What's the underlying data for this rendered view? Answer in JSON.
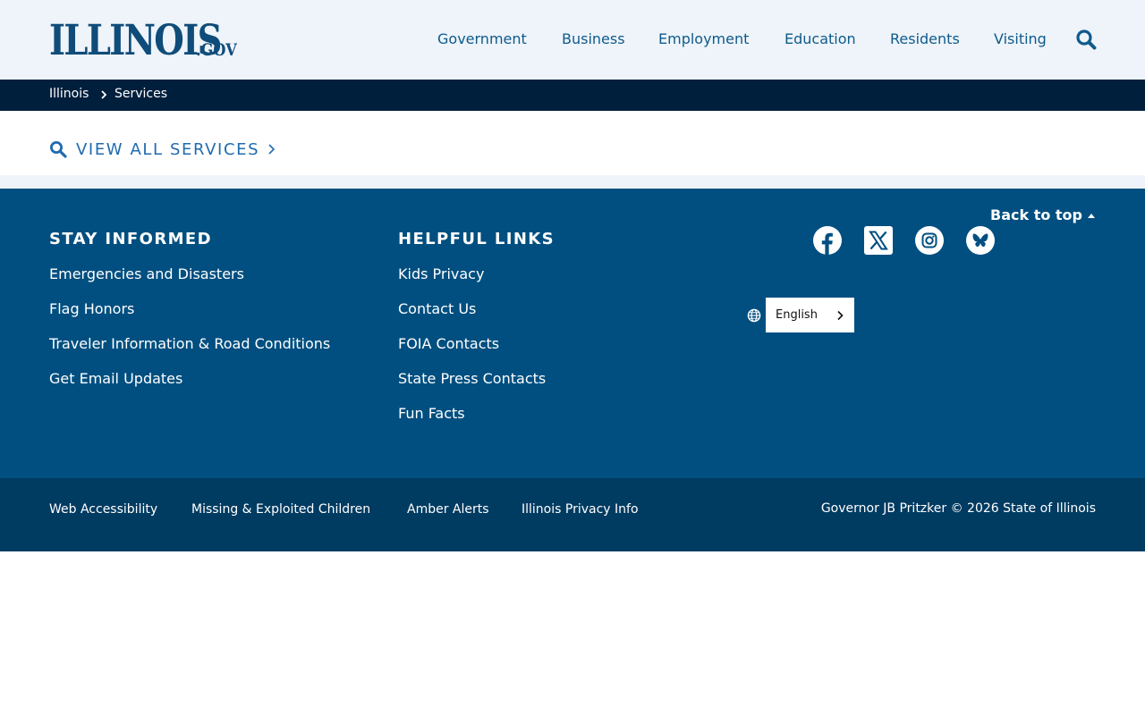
{
  "header": {
    "logo": {
      "main": "ILLINOIS",
      "suffix": ".GOV"
    },
    "nav": [
      "Government",
      "Business",
      "Employment",
      "Education",
      "Residents",
      "Visiting"
    ],
    "search_icon": "search-icon"
  },
  "breadcrumb": {
    "items": [
      "Illinois",
      "Services"
    ],
    "separator_icon": "chevron-right-icon"
  },
  "services": {
    "view_all_label": "VIEW ALL SERVICES",
    "icon": "search-icon",
    "chevron_icon": "chevron-right-icon"
  },
  "footer": {
    "back_to_top": "Back to top",
    "stay_informed": {
      "title": "STAY INFORMED",
      "links": [
        "Emergencies and Disasters",
        "Flag Honors",
        "Traveler Information & Road Conditions",
        "Get Email Updates"
      ]
    },
    "helpful_links": {
      "title": "HELPFUL LINKS",
      "links": [
        "Kids Privacy",
        "Contact Us",
        "FOIA Contacts",
        "State Press Contacts",
        "Fun Facts"
      ]
    },
    "social_icons": [
      "facebook-icon",
      "x-twitter-icon",
      "instagram-icon",
      "bluesky-icon"
    ],
    "language": {
      "selected": "English",
      "icon": "globe-icon"
    }
  },
  "bottom": {
    "links": [
      "Web Accessibility",
      "Missing & Exploited Children",
      "Amber Alerts",
      "Illinois Privacy Info"
    ],
    "copyright": "Governor JB Pritzker © 2026 State of Illinois"
  },
  "colors": {
    "header_bg": "#eef4f9",
    "nav_text": "#0f5a8c",
    "breadcrumb_bg": "#001f3d",
    "accent_link": "#1f6bb0",
    "footer_bg": "#004f80",
    "bottom_bg": "#003b61"
  }
}
